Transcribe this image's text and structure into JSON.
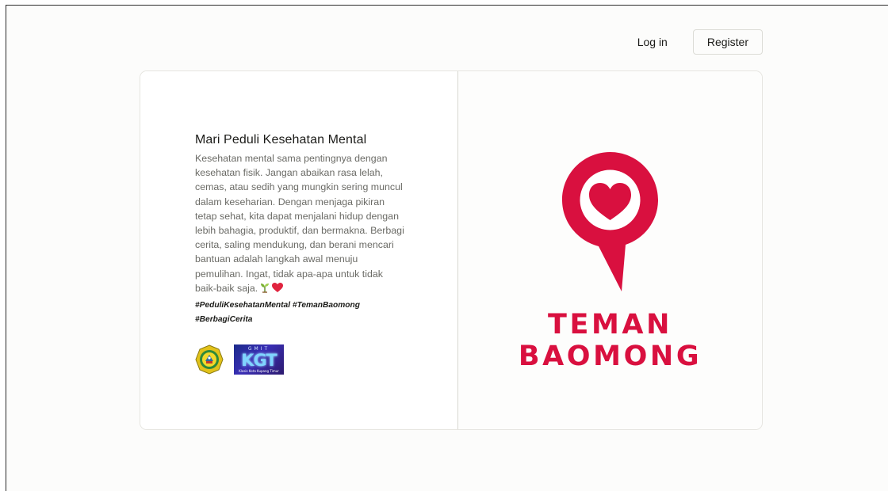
{
  "nav": {
    "login_label": "Log in",
    "register_label": "Register"
  },
  "intro": {
    "title": "Mari Peduli Kesehatan Mental",
    "description": "Kesehatan mental sama pentingnya dengan kesehatan fisik. Jangan abaikan rasa lelah, cemas, atau sedih yang mungkin sering muncul dalam keseharian. Dengan menjaga pikiran tetap sehat, kita dapat menjalani hidup dengan lebih bahagia, produktif, dan bermakna. Berbagi cerita, saling mendukung, dan berani mencari bantuan adalah langkah awal menuju pemulihan. Ingat, tidak apa-apa untuk tidak baik-baik saja.",
    "hashtags": "#PeduliKesehatanMental #TemanBaomong #BerbagiCerita",
    "emojis": [
      "seedling-icon",
      "heart-icon"
    ]
  },
  "partner_logos": {
    "kgt": {
      "top_text": "GMIT",
      "main_text": "KGT",
      "sub_text": "Klasis Kota Kupang Timur"
    }
  },
  "brand": {
    "name": "TEMAN BAOMONG",
    "icon": "chat-heart-icon",
    "color": "#d9103f"
  },
  "colors": {
    "background": "#fcfcfb",
    "card": "#ffffff",
    "text_primary": "#1b1b18",
    "text_secondary": "#6b6b66",
    "accent": "#d9103f"
  }
}
